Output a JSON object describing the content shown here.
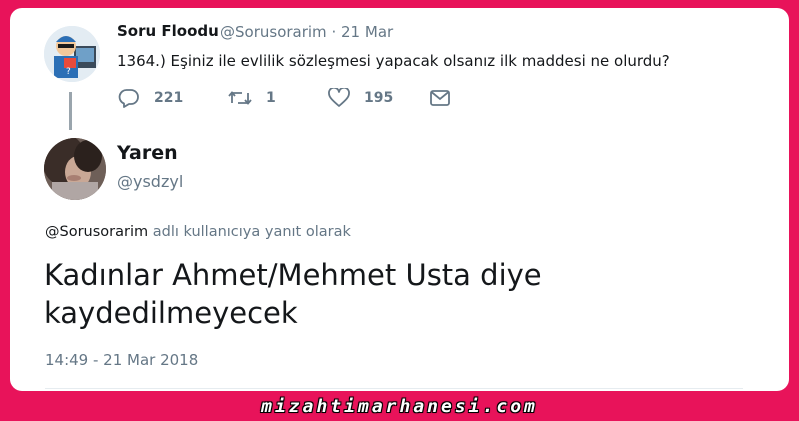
{
  "original_tweet": {
    "display_name": "Soru Floodu",
    "handle": "@Sorusorarim",
    "date": "21 Mar",
    "separator": "·",
    "text": "1364.) Eşiniz ile evlilik sözleşmesi yapacak olsanız ilk maddesi ne olurdu?",
    "avatar_icon": "cartoon-mascot-avatar",
    "actions": {
      "replies": "221",
      "retweets": "1",
      "likes": "195"
    }
  },
  "reply_tweet": {
    "display_name": "Yaren",
    "handle": "@ysdzyl",
    "avatar_icon": "profile-photo-avatar",
    "reply_to_handle": "@Sorusorarim",
    "reply_to_suffix": " adlı kullanıcıya yanıt olarak",
    "text": "Kadınlar Ahmet/Mehmet Usta diye kaydedilmeyecek",
    "timestamp": "14:49 - 21 Mar 2018"
  },
  "watermark": "mizahtimarhanesi.com",
  "colors": {
    "frame": "#e8135a",
    "secondary_text": "#657786",
    "primary_text": "#14171a"
  }
}
